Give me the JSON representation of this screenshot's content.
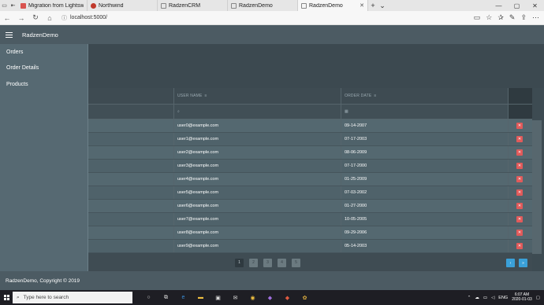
{
  "browser": {
    "tabs": [
      {
        "title": "Migration from Lightswitch",
        "color": "#d9534f",
        "active": false
      },
      {
        "title": "Northwind",
        "color": "#c0392b",
        "active": false
      },
      {
        "title": "RadzenCRM",
        "color": "#888888",
        "active": false
      },
      {
        "title": "RadzenDemo",
        "color": "#888888",
        "active": false
      },
      {
        "title": "RadzenDemo",
        "color": "#888888",
        "active": true
      }
    ],
    "url": "localhost:5000/"
  },
  "app": {
    "title": "RadzenDemo",
    "sidebar": [
      {
        "label": "Orders"
      },
      {
        "label": "Order Details"
      },
      {
        "label": "Products"
      }
    ],
    "footer": "RadzenDemo, Copyright © 2019"
  },
  "grid": {
    "columns": [
      "USER NAME",
      "ORDER DATE"
    ],
    "rows": [
      {
        "user": "user0@example.com",
        "date": "09-14-2007"
      },
      {
        "user": "user1@example.com",
        "date": "07-17-2003"
      },
      {
        "user": "user2@example.com",
        "date": "08-06-2009"
      },
      {
        "user": "user3@example.com",
        "date": "07-17-2000"
      },
      {
        "user": "user4@example.com",
        "date": "01-25-2009"
      },
      {
        "user": "user5@example.com",
        "date": "07-03-2002"
      },
      {
        "user": "user6@example.com",
        "date": "01-27-2000"
      },
      {
        "user": "user7@example.com",
        "date": "10-05-2005"
      },
      {
        "user": "user8@example.com",
        "date": "09-29-2006"
      },
      {
        "user": "user9@example.com",
        "date": "05-14-2003"
      }
    ],
    "pages": [
      "1",
      "2",
      "3",
      "4",
      "5"
    ],
    "active_page": "1",
    "colors": {
      "delete": "#e05a5a",
      "pager_nav": "#3aa0d8"
    }
  },
  "taskbar": {
    "search_placeholder": "Type here to search",
    "lang": "ENG",
    "time": "6:07 AM",
    "date": "2020-01-03"
  }
}
